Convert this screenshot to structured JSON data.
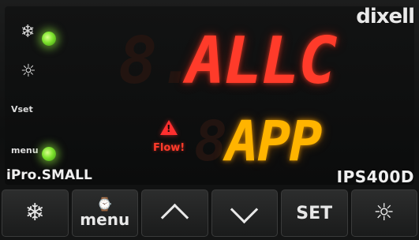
{
  "brand": "dixell",
  "model_left": "iPro.SMALL",
  "model_right": "IPS400D",
  "indicators": [
    {
      "name": "snowflake",
      "glyph": "❄",
      "led_on": true
    },
    {
      "name": "sun",
      "glyph": "☼",
      "led_on": false
    },
    {
      "name": "vset",
      "label": "Vset",
      "led_on": false
    },
    {
      "name": "menu",
      "label": "menu",
      "led_on": true
    }
  ],
  "display": {
    "top_text": "ALLC",
    "bottom_text": "APP",
    "alarm_label": "Flow!"
  },
  "buttons": [
    {
      "id": "defrost",
      "icon": "snowflake-icon",
      "glyph": "❄"
    },
    {
      "id": "menu",
      "icon": "clock-icon",
      "clock": "⌚",
      "label": "menu"
    },
    {
      "id": "up",
      "icon": "chevron-up-icon"
    },
    {
      "id": "down",
      "icon": "chevron-down-icon"
    },
    {
      "id": "set",
      "label": "SET"
    },
    {
      "id": "light",
      "icon": "sun-icon",
      "glyph": "☼"
    }
  ],
  "colors": {
    "top_display": "#ff3b2a",
    "bottom_display": "#ffb400",
    "led_green": "#7de22d",
    "alarm_red": "#ff2f2f"
  }
}
